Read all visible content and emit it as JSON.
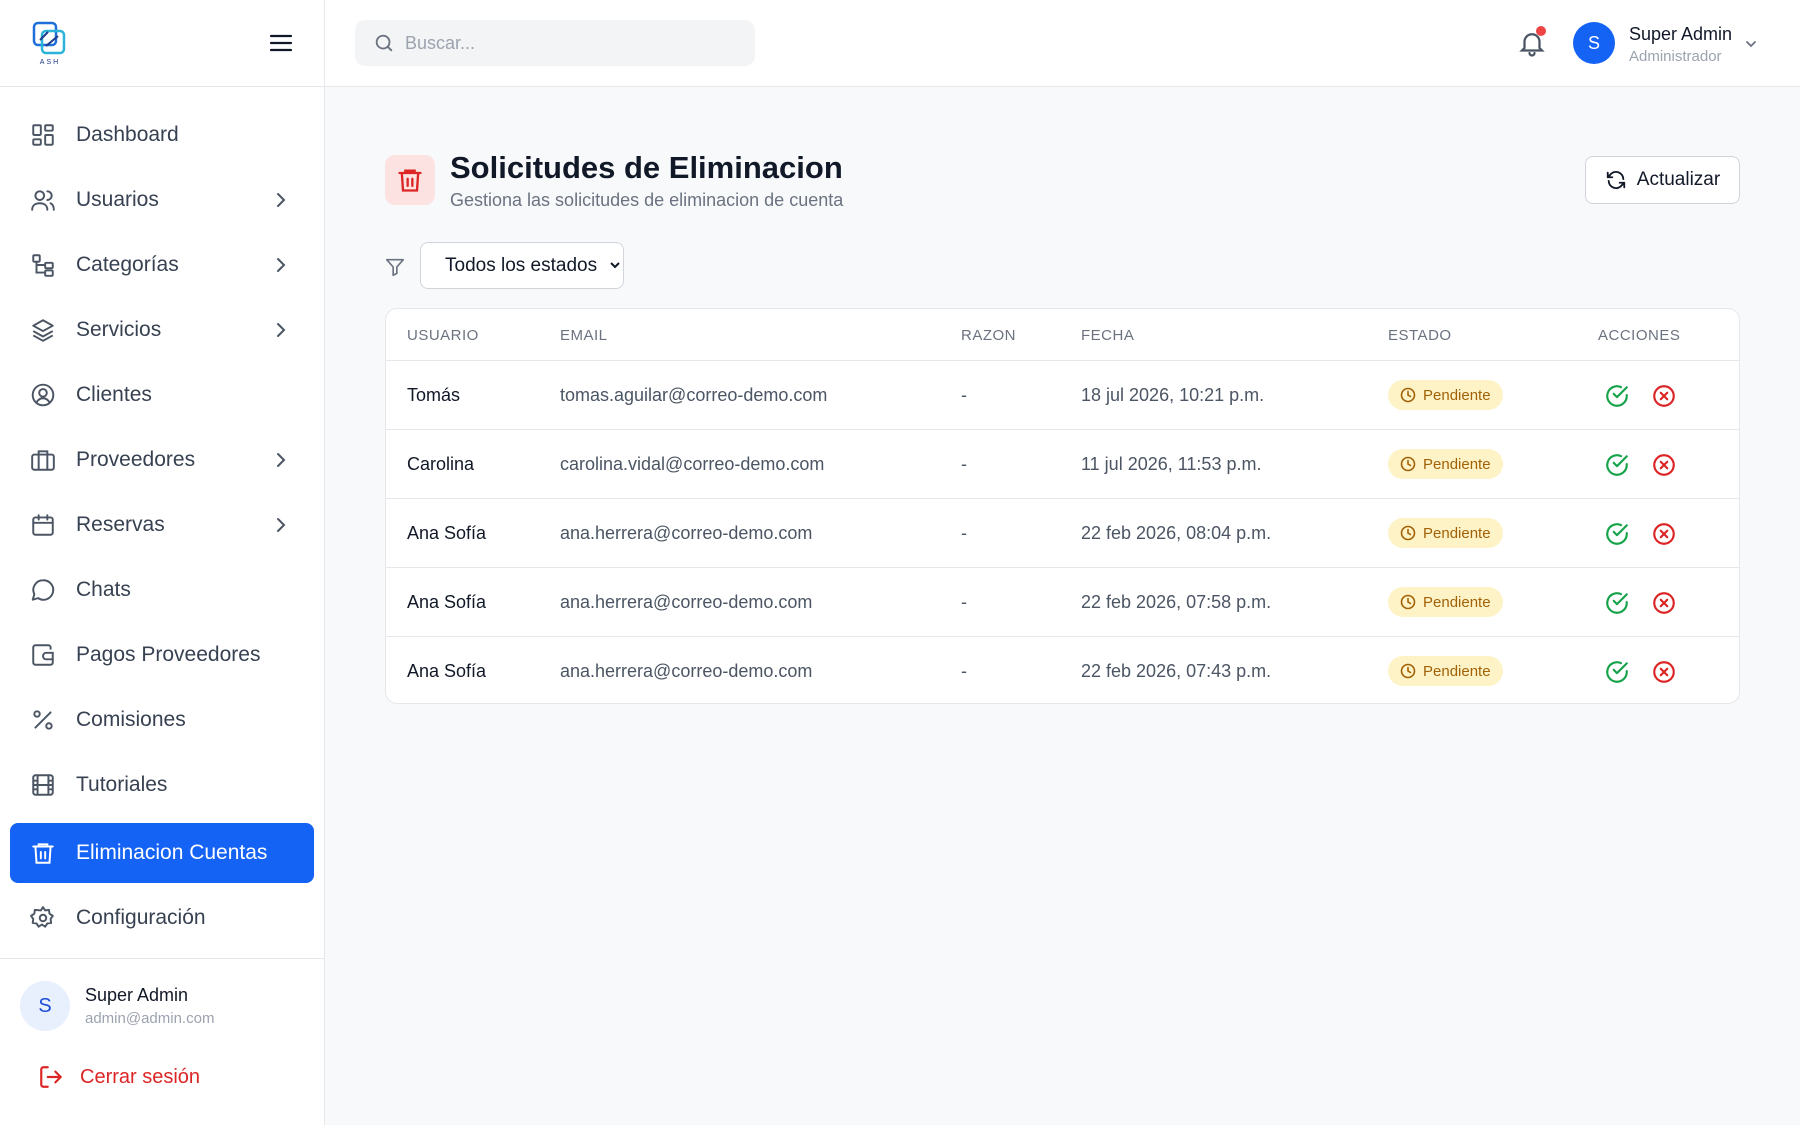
{
  "sidebar": {
    "items": [
      {
        "label": "Dashboard",
        "icon": "dashboard-icon",
        "chevron": false,
        "active": false
      },
      {
        "label": "Usuarios",
        "icon": "users-icon",
        "chevron": true,
        "active": false
      },
      {
        "label": "Categorías",
        "icon": "categories-icon",
        "chevron": true,
        "active": false
      },
      {
        "label": "Servicios",
        "icon": "layers-icon",
        "chevron": true,
        "active": false
      },
      {
        "label": "Clientes",
        "icon": "user-circle-icon",
        "chevron": false,
        "active": false
      },
      {
        "label": "Proveedores",
        "icon": "briefcase-icon",
        "chevron": true,
        "active": false
      },
      {
        "label": "Reservas",
        "icon": "calendar-icon",
        "chevron": true,
        "active": false
      },
      {
        "label": "Chats",
        "icon": "chat-icon",
        "chevron": false,
        "active": false
      },
      {
        "label": "Pagos Proveedores",
        "icon": "wallet-icon",
        "chevron": false,
        "active": false
      },
      {
        "label": "Comisiones",
        "icon": "percent-icon",
        "chevron": false,
        "active": false
      },
      {
        "label": "Tutoriales",
        "icon": "film-icon",
        "chevron": false,
        "active": false
      },
      {
        "label": "Eliminacion Cuentas",
        "icon": "trash-icon",
        "chevron": false,
        "active": true
      },
      {
        "label": "Configuración",
        "icon": "gear-icon",
        "chevron": false,
        "active": false
      }
    ],
    "footer": {
      "avatar_initial": "S",
      "name": "Super Admin",
      "email": "admin@admin.com",
      "logout_label": "Cerrar sesión"
    }
  },
  "topbar": {
    "search_placeholder": "Buscar...",
    "user": {
      "initial": "S",
      "name": "Super Admin",
      "role": "Administrador"
    }
  },
  "main": {
    "title": "Solicitudes de Eliminacion",
    "subtitle": "Gestiona las solicitudes de eliminacion de cuenta",
    "refresh_label": "Actualizar",
    "filter": {
      "selected": "Todos los estados"
    },
    "table": {
      "columns": [
        "USUARIO",
        "EMAIL",
        "RAZON",
        "FECHA",
        "ESTADO",
        "ACCIONES"
      ],
      "rows": [
        {
          "usuario": "Tomás",
          "email": "tomas.aguilar@correo-demo.com",
          "razon": "-",
          "fecha": "18 jul 2026, 10:21 p.m.",
          "estado": "Pendiente"
        },
        {
          "usuario": "Carolina",
          "email": "carolina.vidal@correo-demo.com",
          "razon": "-",
          "fecha": "11 jul 2026, 11:53 p.m.",
          "estado": "Pendiente"
        },
        {
          "usuario": "Ana Sofía",
          "email": "ana.herrera@correo-demo.com",
          "razon": "-",
          "fecha": "22 feb 2026, 08:04 p.m.",
          "estado": "Pendiente"
        },
        {
          "usuario": "Ana Sofía",
          "email": "ana.herrera@correo-demo.com",
          "razon": "-",
          "fecha": "22 feb 2026, 07:58 p.m.",
          "estado": "Pendiente"
        },
        {
          "usuario": "Ana Sofía",
          "email": "ana.herrera@correo-demo.com",
          "razon": "-",
          "fecha": "22 feb 2026, 07:43 p.m.",
          "estado": "Pendiente"
        }
      ]
    }
  },
  "colors": {
    "accent": "#1563f5",
    "danger": "#dc2626",
    "success": "#16a34a",
    "pending_bg": "#fef3c7",
    "pending_text": "#a16207"
  }
}
